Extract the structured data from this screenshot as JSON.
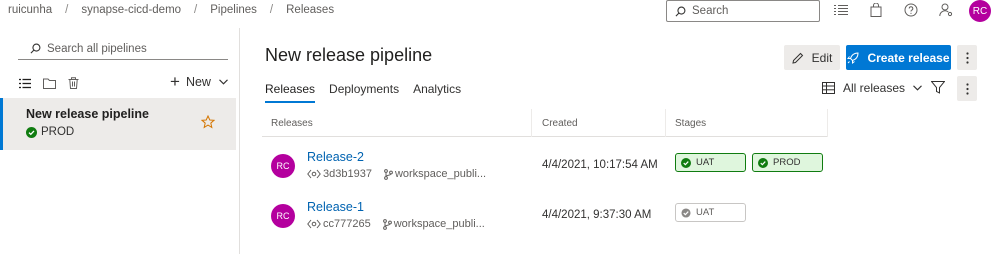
{
  "breadcrumb": [
    "ruicunha",
    "synapse-cicd-demo",
    "Pipelines",
    "Releases"
  ],
  "top_search": {
    "placeholder": "Search"
  },
  "user": {
    "initials": "RC",
    "color": "#b4009e"
  },
  "left": {
    "search_placeholder": "Search all pipelines",
    "new_label": "New",
    "pipeline": {
      "name": "New release pipeline",
      "status": "PROD"
    }
  },
  "main": {
    "title": "New release pipeline",
    "edit_label": "Edit",
    "create_label": "Create release",
    "tabs": [
      {
        "label": "Releases",
        "active": true
      },
      {
        "label": "Deployments",
        "active": false
      },
      {
        "label": "Analytics",
        "active": false
      }
    ],
    "filter_label": "All releases"
  },
  "table": {
    "headers": [
      "Releases",
      "Created",
      "Stages"
    ],
    "rows": [
      {
        "initials": "RC",
        "name": "Release-2",
        "commit": "3d3b1937",
        "branch": "workspace_publi...",
        "created": "4/4/2021, 10:17:54 AM",
        "stages": [
          {
            "name": "UAT",
            "status": "succeeded"
          },
          {
            "name": "PROD",
            "status": "succeeded"
          }
        ]
      },
      {
        "initials": "RC",
        "name": "Release-1",
        "commit": "cc777265",
        "branch": "workspace_publi...",
        "created": "4/4/2021, 9:37:30 AM",
        "stages": [
          {
            "name": "UAT",
            "status": "not-deployed"
          }
        ]
      }
    ]
  },
  "colors": {
    "accent": "#0078d4",
    "success": "#107c10",
    "avatar": "#b4009e",
    "star": "#d47500"
  }
}
